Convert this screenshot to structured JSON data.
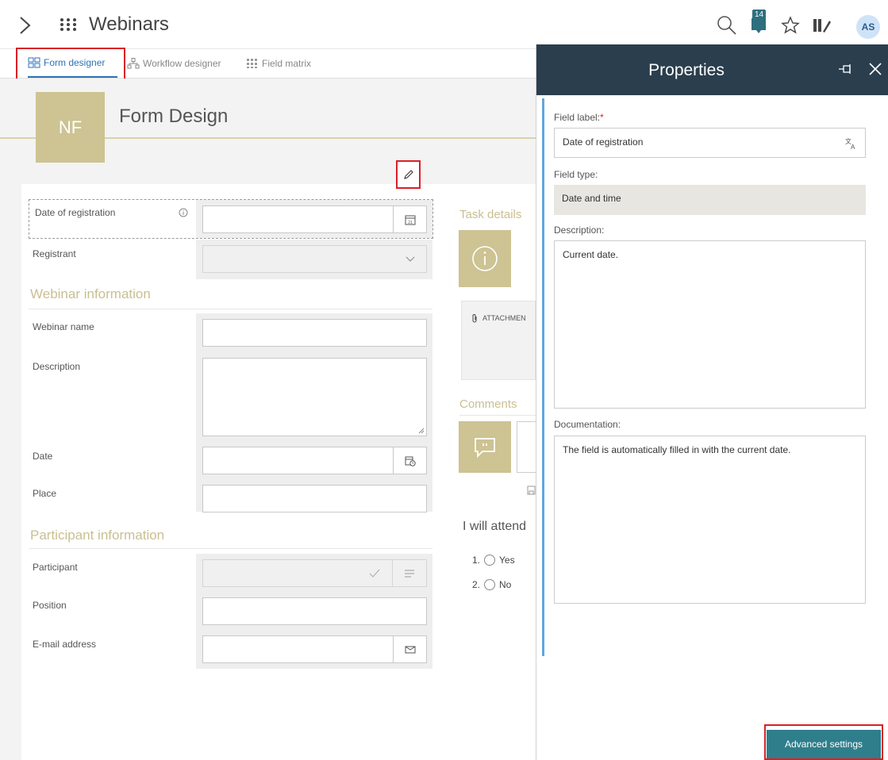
{
  "header": {
    "app_title": "Webinars",
    "notification_count": "14",
    "avatar_initials": "AS",
    "icons": [
      "chevron-right-icon",
      "app-grid-icon",
      "search-icon",
      "notification-icon",
      "star-icon",
      "checklist-icon"
    ]
  },
  "tabs": [
    {
      "label": "Form designer",
      "icon": "form-designer-icon",
      "active": true
    },
    {
      "label": "Workflow designer",
      "icon": "workflow-icon",
      "active": false
    },
    {
      "label": "Field matrix",
      "icon": "matrix-icon",
      "active": false
    }
  ],
  "form": {
    "badge": "NF",
    "title": "Form Design",
    "fields": {
      "date_of_registration": "Date of registration",
      "registrant": "Registrant",
      "webinar_name": "Webinar name",
      "description": "Description",
      "date": "Date",
      "place": "Place",
      "participant": "Participant",
      "position": "Position",
      "email": "E-mail address"
    },
    "sections": {
      "webinar_info": "Webinar information",
      "participant_info": "Participant information"
    },
    "calendar_day": "21"
  },
  "side": {
    "task_details": "Task details",
    "attachments": "ATTACHMEN",
    "comments": "Comments",
    "question": "I will attend",
    "options": [
      {
        "num": "1.",
        "label": "Yes"
      },
      {
        "num": "2.",
        "label": "No"
      }
    ]
  },
  "properties": {
    "title": "Properties",
    "field_label_label": "Field label:",
    "required_mark": "*",
    "field_label_value": "Date of registration",
    "field_type_label": "Field type:",
    "field_type_value": "Date and time",
    "description_label": "Description:",
    "description_value": "Current date.",
    "documentation_label": "Documentation:",
    "documentation_value": "The field is automatically filled in with the current date.",
    "advanced_button": "Advanced settings"
  },
  "colors": {
    "accent_gold": "#cdc393",
    "panel_header": "#2b3e4d",
    "button": "#2f7e8c",
    "highlight_red": "#d92027",
    "active_tab": "#2d72b8"
  }
}
